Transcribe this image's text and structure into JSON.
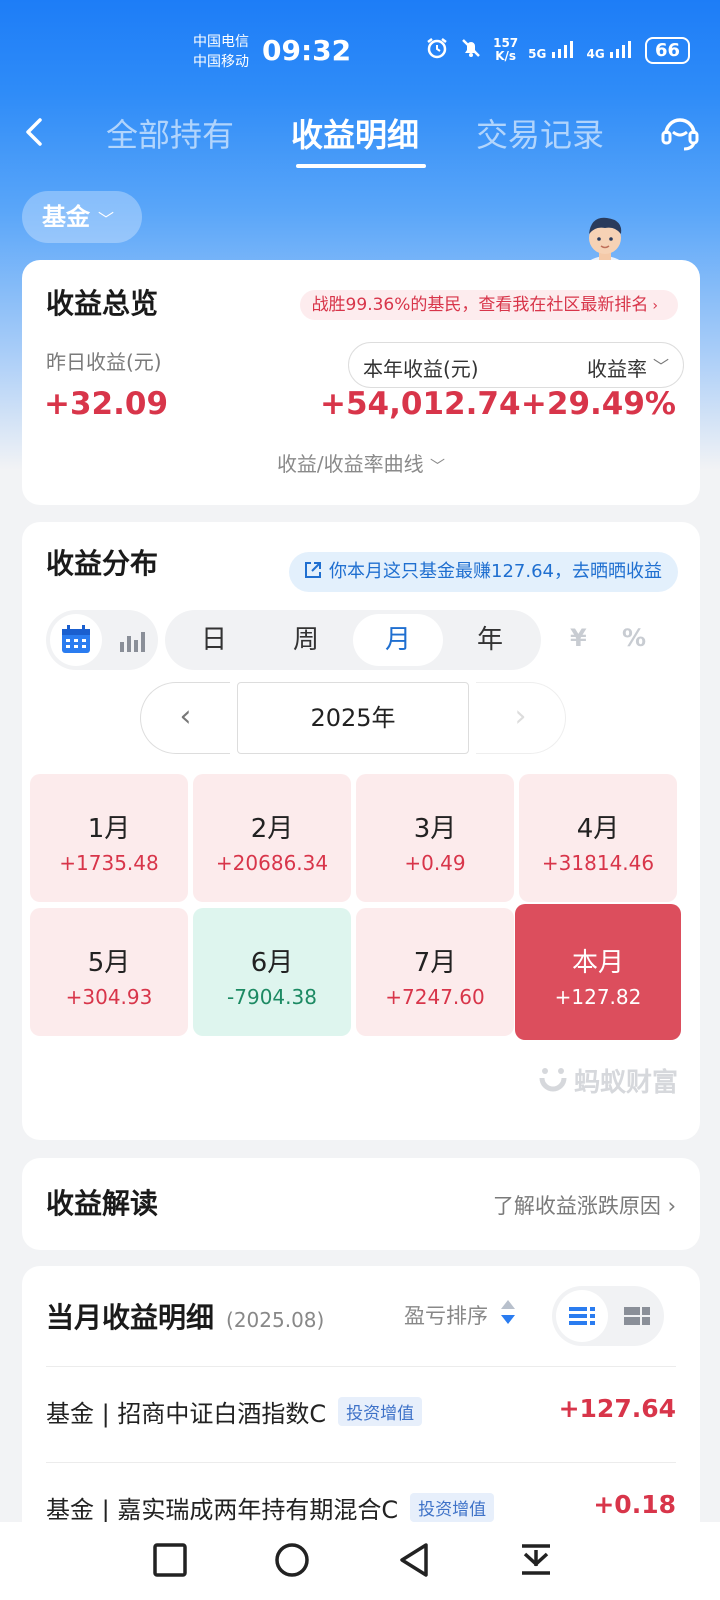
{
  "status_bar": {
    "carrier_1": "中国电信",
    "carrier_2": "中国移动",
    "time": "09:32",
    "speed_value": "157",
    "speed_unit": "K/s",
    "network_1": "5G",
    "network_2": "4G",
    "battery": "66"
  },
  "nav": {
    "tabs": [
      {
        "label": "全部持有",
        "active": false
      },
      {
        "label": "收益明细",
        "active": true
      },
      {
        "label": "交易记录",
        "active": false
      }
    ]
  },
  "filter": {
    "label": "基金"
  },
  "overview": {
    "title": "收益总览",
    "rank_banner": "战胜99.36%的基民，查看我在社区最新排名",
    "yesterday_label": "昨日收益(元)",
    "yesterday_value": "+32.09",
    "year_label": "本年收益(元)",
    "rate_label": "收益率",
    "year_value": "+54,012.74",
    "rate_value": "+29.49%",
    "curve_toggle": "收益/收益率曲线"
  },
  "distribution": {
    "title": "收益分布",
    "share_banner": "你本月这只基金最赚127.64，去晒晒收益",
    "periods": [
      "日",
      "周",
      "月",
      "年"
    ],
    "selected_period": "月",
    "unit_amount": "¥",
    "unit_percent": "%",
    "year": "2025年",
    "months": [
      {
        "label": "1月",
        "value": "+1735.48",
        "state": "gain"
      },
      {
        "label": "2月",
        "value": "+20686.34",
        "state": "gain"
      },
      {
        "label": "3月",
        "value": "+0.49",
        "state": "gain"
      },
      {
        "label": "4月",
        "value": "+31814.46",
        "state": "gain"
      },
      {
        "label": "5月",
        "value": "+304.93",
        "state": "gain"
      },
      {
        "label": "6月",
        "value": "-7904.38",
        "state": "loss"
      },
      {
        "label": "7月",
        "value": "+7247.60",
        "state": "gain"
      },
      {
        "label": "本月",
        "value": "+127.82",
        "state": "current"
      }
    ],
    "watermark": "蚂蚁财富"
  },
  "interpretation": {
    "title": "收益解读",
    "link": "了解收益涨跌原因"
  },
  "detail": {
    "title": "当月收益明细",
    "period": "(2025.08)",
    "sort_label": "盈亏排序",
    "rows": [
      {
        "name": "基金 | 招商中证白酒指数C",
        "tag": "投资增值",
        "value": "+127.64"
      },
      {
        "name": "基金 | 嘉实瑞成两年持有期混合C",
        "tag": "投资增值",
        "value": "+0.18"
      }
    ]
  },
  "colors": {
    "primary_blue": "#1d7df7",
    "gain_red": "#d8354a",
    "loss_green": "#1c8a63",
    "current_month": "#dc4e5d"
  }
}
